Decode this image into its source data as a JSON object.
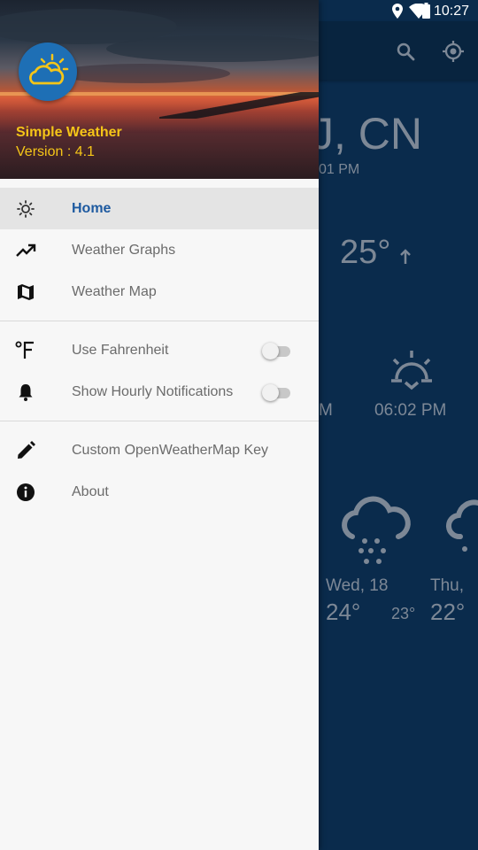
{
  "status_bar": {
    "time": "10:27",
    "icons": [
      "location-icon",
      "wifi-icon",
      "battery-icon"
    ]
  },
  "background": {
    "toolbar_icons": [
      "search-icon",
      "my-location-icon"
    ],
    "city": "J, CN",
    "updated": "01 PM",
    "current_temp": "25°",
    "sunrise_partial": "M",
    "sunset_time": "06:02 PM",
    "forecast": [
      {
        "day": "Wed, 18",
        "high": "24°",
        "low": "23°",
        "icon": "rain-cloud-icon"
      },
      {
        "day": "Thu,",
        "high": "22°",
        "icon": "cloud-icon"
      }
    ],
    "accent_color": "#0a2b4c"
  },
  "drawer": {
    "header": {
      "app_name": "Simple Weather",
      "version": "Version : 4.1",
      "name_color": "#f5c518"
    },
    "items": [
      {
        "label": "Home",
        "icon": "sun-icon",
        "active": true
      },
      {
        "label": "Weather Graphs",
        "icon": "trending-up-icon"
      },
      {
        "label": "Weather Map",
        "icon": "map-icon"
      },
      {
        "label": "Use Fahrenheit",
        "icon": "fahrenheit-icon",
        "toggle": false
      },
      {
        "label": "Show Hourly Notifications",
        "icon": "bell-icon",
        "toggle": false
      },
      {
        "label": "Custom OpenWeatherMap Key",
        "icon": "pencil-icon"
      },
      {
        "label": "About",
        "icon": "info-icon"
      }
    ],
    "active_color": "#1e5aa0"
  }
}
